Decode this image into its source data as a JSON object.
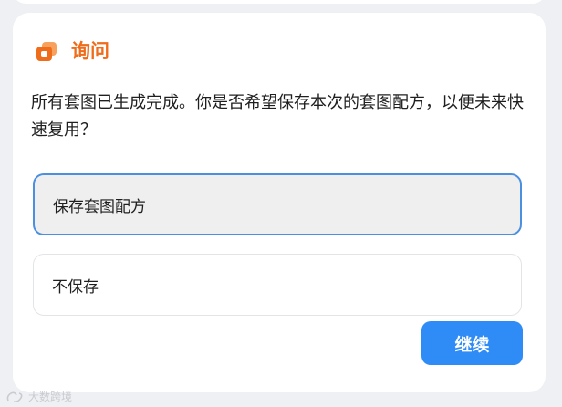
{
  "dialog": {
    "title": "询问",
    "icon": "stacked-cards-icon",
    "question": "所有套图已生成完成。你是否希望保存本次的套图配方，以便未来快速复用？",
    "options": [
      {
        "label": "保存套图配方",
        "selected": true
      },
      {
        "label": "不保存",
        "selected": false
      }
    ],
    "continue_label": "继续"
  },
  "watermark": {
    "text": "大数跨境"
  },
  "colors": {
    "accent_orange": "#ef6c1a",
    "primary_blue": "#2f8cf7",
    "selected_border": "#4b8fe0"
  }
}
